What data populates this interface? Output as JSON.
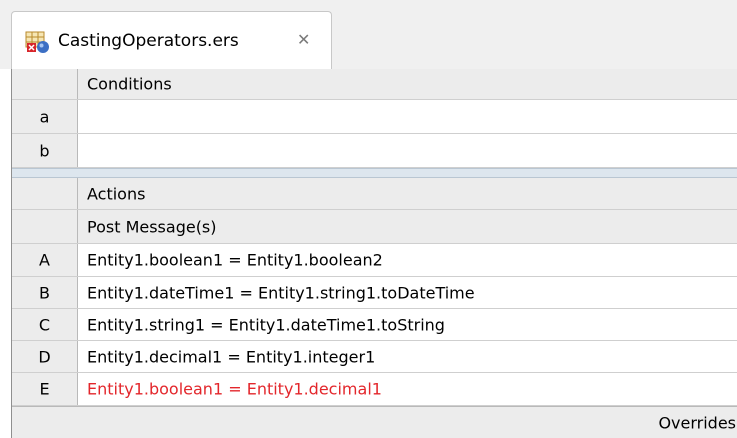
{
  "tab": {
    "title": "CastingOperators.ers",
    "close_glyph": "✕",
    "icon": "rule-table-icon"
  },
  "conditions": {
    "header": "Conditions",
    "rows": [
      {
        "label": "a",
        "text": ""
      },
      {
        "label": "b",
        "text": ""
      }
    ]
  },
  "actions": {
    "header": "Actions",
    "subheader": "Post Message(s)",
    "rows": [
      {
        "label": "A",
        "text": "Entity1.boolean1 = Entity1.boolean2",
        "error": false
      },
      {
        "label": "B",
        "text": "Entity1.dateTime1 = Entity1.string1.toDateTime",
        "error": false
      },
      {
        "label": "C",
        "text": "Entity1.string1 = Entity1.dateTime1.toString",
        "error": false
      },
      {
        "label": "D",
        "text": "Entity1.decimal1 = Entity1.integer1",
        "error": false
      },
      {
        "label": "E",
        "text": "Entity1.boolean1 = Entity1.decimal1",
        "error": true
      }
    ]
  },
  "footer": {
    "overrides_label": "Overrides"
  },
  "colors": {
    "error_text": "#e3262b",
    "header_bg": "#ececec",
    "separator": "#dde6ee"
  }
}
